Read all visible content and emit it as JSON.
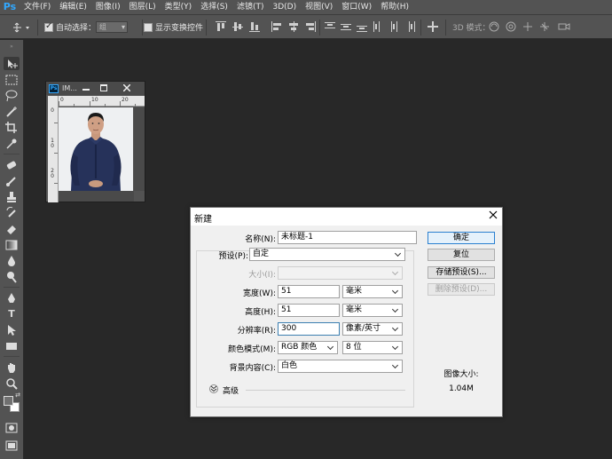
{
  "menubar": {
    "logo": "Ps",
    "items": [
      "文件(F)",
      "编辑(E)",
      "图像(I)",
      "图层(L)",
      "类型(Y)",
      "选择(S)",
      "滤镜(T)",
      "3D(D)",
      "视图(V)",
      "窗口(W)",
      "帮助(H)"
    ]
  },
  "options": {
    "auto_select_label": "自动选择：",
    "auto_select_checked": true,
    "auto_select_target": "组",
    "show_transform_label": "显示变换控件",
    "show_transform_checked": false,
    "mode_3d_label": "3D 模式："
  },
  "image_window": {
    "ps_badge": "Ps",
    "title": "IM...",
    "ruler_top": [
      "0",
      "10",
      "20"
    ],
    "ruler_left": [
      "0",
      "1 0",
      "2 0"
    ]
  },
  "dialog": {
    "title": "新建",
    "name_label": "名称(N):",
    "name_value": "未标题-1",
    "preset_label": "预设(P):",
    "preset_value": "自定",
    "size_label": "大小(I):",
    "size_value": "",
    "width_label": "宽度(W):",
    "width_value": "51",
    "width_unit": "毫米",
    "height_label": "高度(H):",
    "height_value": "51",
    "height_unit": "毫米",
    "resolution_label": "分辨率(R):",
    "resolution_value": "300",
    "resolution_unit": "像素/英寸",
    "color_mode_label": "颜色模式(M):",
    "color_mode_value": "RGB 颜色",
    "bit_depth_value": "8 位",
    "background_label": "背景内容(C):",
    "background_value": "白色",
    "advanced_label": "高级",
    "buttons": {
      "ok": "确定",
      "reset": "复位",
      "save_preset": "存储预设(S)...",
      "delete_preset": "删除预设(D)..."
    },
    "image_size_label": "图像大小:",
    "image_size_value": "1.04M"
  },
  "colors": {
    "app_bg": "#282828",
    "panel_bg": "#535353",
    "accent": "#31a8ff",
    "dialog_default_border": "#2a7fd0"
  }
}
